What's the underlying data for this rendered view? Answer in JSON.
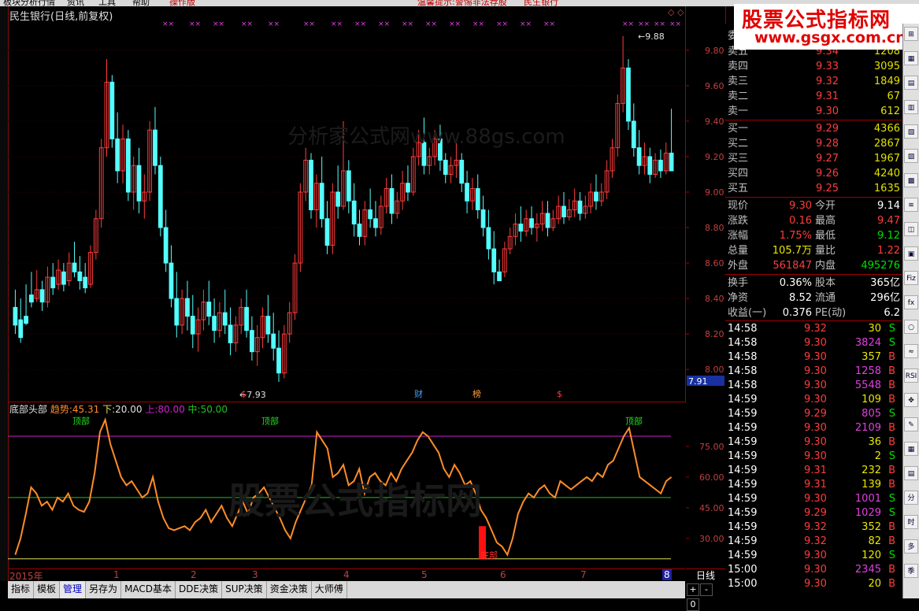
{
  "top_menu": [
    "板块分析行情",
    "资讯",
    "工具",
    "帮助",
    "操作版"
  ],
  "top_menu_highlight": [
    "温馨提示:警惕非法荐股",
    "民生银行"
  ],
  "chart": {
    "title": "民生银行(日线,前复权)",
    "watermark": "分析家公式网www.88gs.com",
    "watermark2": "股票公式指标网",
    "price_ticks": [
      "9.80",
      "9.60",
      "9.40",
      "9.20",
      "9.00",
      "8.80",
      "8.60",
      "8.40",
      "8.20",
      "8.00"
    ],
    "current_price_tag": "7.91",
    "high_label": "9.88",
    "low_label": "7.93",
    "event_markers": [
      "$",
      "财",
      "榜",
      "$"
    ]
  },
  "indicator": {
    "name": "底部头部",
    "trend_label": "趋势:",
    "trend_value": "45.31",
    "lower_label": "下:",
    "lower_value": "20.00",
    "upper_label": "上:",
    "upper_value": "80.00",
    "mid_label": "中:",
    "mid_value": "50.00",
    "ticks": [
      "75.00",
      "60.00",
      "45.00",
      "30.00"
    ],
    "top_label": "顶部",
    "bottom_label": "底部"
  },
  "date_axis": [
    "2015年",
    "1",
    "2",
    "3",
    "4",
    "5",
    "6",
    "7",
    "8"
  ],
  "period": "日线",
  "zoom_buttons": [
    "+",
    "-",
    "0"
  ],
  "tabs": [
    "指标",
    "模板",
    "管理",
    "另存为",
    "MACD基本",
    "DDE决策",
    "SUP决策",
    "资金决策",
    "大师傅"
  ],
  "tabs_active": "管理",
  "banner": {
    "line1": "股票公式指标网",
    "line2": "www.gsgx.com.cn"
  },
  "order_book": {
    "header_label": "委",
    "sell": [
      {
        "label": "卖五",
        "price": "9.34",
        "vol": "1208"
      },
      {
        "label": "卖四",
        "price": "9.33",
        "vol": "3095"
      },
      {
        "label": "卖三",
        "price": "9.32",
        "vol": "1849"
      },
      {
        "label": "卖二",
        "price": "9.31",
        "vol": "67"
      },
      {
        "label": "卖一",
        "price": "9.30",
        "vol": "612"
      }
    ],
    "buy": [
      {
        "label": "买一",
        "price": "9.29",
        "vol": "4366"
      },
      {
        "label": "买二",
        "price": "9.28",
        "vol": "2867"
      },
      {
        "label": "买三",
        "price": "9.27",
        "vol": "1967"
      },
      {
        "label": "买四",
        "price": "9.26",
        "vol": "4240"
      },
      {
        "label": "买五",
        "price": "9.25",
        "vol": "1635"
      }
    ]
  },
  "stats": [
    {
      "l1": "现价",
      "v1": "9.30",
      "c1": "red",
      "l2": "今开",
      "v2": "9.14",
      "c2": "white"
    },
    {
      "l1": "涨跌",
      "v1": "0.16",
      "c1": "red",
      "l2": "最高",
      "v2": "9.47",
      "c2": "red"
    },
    {
      "l1": "涨幅",
      "v1": "1.75%",
      "c1": "red",
      "l2": "最低",
      "v2": "9.12",
      "c2": "green"
    },
    {
      "l1": "总量",
      "v1": "105.7万",
      "c1": "yellow",
      "l2": "量比",
      "v2": "1.22",
      "c2": "red"
    },
    {
      "l1": "外盘",
      "v1": "561847",
      "c1": "red",
      "l2": "内盘",
      "v2": "495276",
      "c2": "green"
    }
  ],
  "stats2": [
    {
      "l1": "换手",
      "v1": "0.36%",
      "l2": "股本",
      "v2": "365亿"
    },
    {
      "l1": "净资",
      "v1": "8.52",
      "l2": "流通",
      "v2": "296亿"
    },
    {
      "l1": "收益(一)",
      "v1": "0.376",
      "l2": "PE(动)",
      "v2": "6.2"
    }
  ],
  "ticks": [
    {
      "t": "14:58",
      "p": "9.32",
      "v": "30",
      "s": "S",
      "vc": "yellow",
      "sc": "green"
    },
    {
      "t": "14:58",
      "p": "9.30",
      "v": "3824",
      "s": "S",
      "vc": "magenta",
      "sc": "green"
    },
    {
      "t": "14:58",
      "p": "9.30",
      "v": "357",
      "s": "B",
      "vc": "yellow",
      "sc": "red"
    },
    {
      "t": "14:58",
      "p": "9.30",
      "v": "1258",
      "s": "B",
      "vc": "magenta",
      "sc": "red"
    },
    {
      "t": "14:58",
      "p": "9.30",
      "v": "5548",
      "s": "B",
      "vc": "magenta",
      "sc": "red"
    },
    {
      "t": "14:59",
      "p": "9.30",
      "v": "109",
      "s": "B",
      "vc": "yellow",
      "sc": "red"
    },
    {
      "t": "14:59",
      "p": "9.29",
      "v": "805",
      "s": "S",
      "vc": "magenta",
      "sc": "green"
    },
    {
      "t": "14:59",
      "p": "9.30",
      "v": "2109",
      "s": "B",
      "vc": "magenta",
      "sc": "red"
    },
    {
      "t": "14:59",
      "p": "9.30",
      "v": "36",
      "s": "B",
      "vc": "yellow",
      "sc": "red"
    },
    {
      "t": "14:59",
      "p": "9.30",
      "v": "2",
      "s": "S",
      "vc": "yellow",
      "sc": "green"
    },
    {
      "t": "14:59",
      "p": "9.31",
      "v": "232",
      "s": "B",
      "vc": "yellow",
      "sc": "red"
    },
    {
      "t": "14:59",
      "p": "9.31",
      "v": "139",
      "s": "B",
      "vc": "yellow",
      "sc": "red"
    },
    {
      "t": "14:59",
      "p": "9.30",
      "v": "1001",
      "s": "S",
      "vc": "magenta",
      "sc": "green"
    },
    {
      "t": "14:59",
      "p": "9.29",
      "v": "1029",
      "s": "S",
      "vc": "magenta",
      "sc": "green"
    },
    {
      "t": "14:59",
      "p": "9.32",
      "v": "352",
      "s": "B",
      "vc": "yellow",
      "sc": "red"
    },
    {
      "t": "14:59",
      "p": "9.32",
      "v": "82",
      "s": "B",
      "vc": "yellow",
      "sc": "red"
    },
    {
      "t": "14:59",
      "p": "9.30",
      "v": "120",
      "s": "S",
      "vc": "yellow",
      "sc": "green"
    },
    {
      "t": "15:00",
      "p": "9.30",
      "v": "2345",
      "s": "B",
      "vc": "magenta",
      "sc": "red"
    },
    {
      "t": "15:00",
      "p": "9.30",
      "v": "20",
      "s": "B",
      "vc": "yellow",
      "sc": "red"
    }
  ],
  "toolbox": [
    "⊞",
    "▦",
    "▤",
    "▥",
    "▧",
    "▨",
    "▩",
    "≋",
    "◫",
    "▣",
    "Fiz",
    "fx",
    "○",
    "≈",
    "RSI",
    "✥",
    "✎",
    "▦",
    "▤",
    "分",
    "时",
    "多",
    "季"
  ],
  "colors": {
    "up": "#ff3c3c",
    "down": "#54ffff",
    "indicator": "#ff8c28",
    "upper_line": "#d020d0",
    "mid_line": "#20c020",
    "lower_line": "#e0e060"
  },
  "chart_data": {
    "type": "candlestick",
    "price_range": [
      7.85,
      9.95
    ],
    "indicator_range": [
      18,
      90
    ],
    "candles": [
      [
        8.35,
        8.45,
        8.25,
        8.2
      ],
      [
        8.28,
        8.4,
        8.18,
        8.15
      ],
      [
        8.3,
        8.48,
        8.26,
        8.25
      ],
      [
        8.42,
        8.55,
        8.38,
        8.35
      ],
      [
        8.4,
        8.56,
        8.45,
        8.38
      ],
      [
        8.45,
        8.5,
        8.38,
        8.33
      ],
      [
        8.38,
        8.58,
        8.52,
        8.35
      ],
      [
        8.52,
        8.6,
        8.46,
        8.42
      ],
      [
        8.48,
        8.62,
        8.56,
        8.45
      ],
      [
        8.55,
        8.6,
        8.48,
        8.44
      ],
      [
        8.5,
        8.66,
        8.6,
        8.47
      ],
      [
        8.6,
        8.72,
        8.55,
        8.52
      ],
      [
        8.55,
        8.64,
        8.5,
        8.45
      ],
      [
        8.52,
        8.6,
        8.46,
        8.43
      ],
      [
        8.48,
        8.7,
        8.66,
        8.46
      ],
      [
        8.66,
        8.9,
        8.85,
        8.62
      ],
      [
        8.85,
        9.3,
        9.25,
        8.8
      ],
      [
        9.25,
        9.75,
        9.62,
        9.2
      ],
      [
        9.62,
        9.66,
        9.3,
        9.25
      ],
      [
        9.3,
        9.45,
        9.12,
        9.05
      ],
      [
        9.12,
        9.38,
        9.3,
        9.05
      ],
      [
        9.3,
        9.35,
        9.0,
        8.95
      ],
      [
        9.0,
        9.2,
        9.15,
        8.9
      ],
      [
        9.15,
        9.25,
        8.95,
        8.88
      ],
      [
        8.95,
        9.1,
        9.0,
        8.85
      ],
      [
        9.0,
        9.4,
        9.35,
        8.95
      ],
      [
        9.35,
        9.48,
        9.15,
        9.1
      ],
      [
        9.15,
        9.2,
        8.8,
        8.75
      ],
      [
        8.8,
        8.9,
        8.6,
        8.55
      ],
      [
        8.6,
        8.7,
        8.4,
        8.35
      ],
      [
        8.4,
        8.55,
        8.25,
        8.18
      ],
      [
        8.25,
        8.45,
        8.4,
        8.2
      ],
      [
        8.4,
        8.5,
        8.3,
        8.22
      ],
      [
        8.3,
        8.42,
        8.2,
        8.12
      ],
      [
        8.2,
        8.35,
        8.28,
        8.1
      ],
      [
        8.28,
        8.45,
        8.38,
        8.22
      ],
      [
        8.38,
        8.5,
        8.3,
        8.25
      ],
      [
        8.3,
        8.4,
        8.22,
        8.15
      ],
      [
        8.22,
        8.38,
        8.32,
        8.18
      ],
      [
        8.32,
        8.45,
        8.25,
        8.2
      ],
      [
        8.25,
        8.35,
        8.15,
        8.08
      ],
      [
        8.15,
        8.3,
        8.25,
        8.1
      ],
      [
        8.25,
        8.4,
        8.35,
        8.2
      ],
      [
        8.35,
        8.45,
        8.22,
        8.18
      ],
      [
        8.22,
        8.3,
        8.1,
        8.05
      ],
      [
        8.1,
        8.25,
        8.18,
        8.02
      ],
      [
        8.18,
        8.35,
        8.3,
        8.12
      ],
      [
        8.3,
        8.42,
        8.2,
        8.15
      ],
      [
        8.2,
        8.32,
        8.12,
        8.05
      ],
      [
        8.12,
        8.22,
        7.98,
        7.93
      ],
      [
        7.98,
        8.25,
        8.2,
        7.95
      ],
      [
        8.2,
        8.38,
        8.32,
        8.15
      ],
      [
        8.32,
        8.65,
        8.6,
        8.28
      ],
      [
        8.6,
        9.05,
        9.0,
        8.55
      ],
      [
        9.0,
        9.25,
        9.18,
        8.95
      ],
      [
        9.18,
        9.22,
        8.9,
        8.85
      ],
      [
        8.9,
        9.1,
        9.05,
        8.8
      ],
      [
        9.05,
        9.2,
        8.85,
        8.8
      ],
      [
        8.85,
        8.95,
        8.7,
        8.65
      ],
      [
        8.7,
        9.05,
        9.0,
        8.65
      ],
      [
        9.0,
        9.15,
        8.92,
        8.85
      ],
      [
        8.92,
        9.4,
        9.12,
        8.9
      ],
      [
        9.12,
        9.18,
        8.95,
        8.88
      ],
      [
        8.95,
        9.05,
        8.82,
        8.75
      ],
      [
        8.82,
        8.9,
        8.75,
        8.7
      ],
      [
        8.75,
        8.95,
        8.9,
        8.7
      ],
      [
        8.9,
        9.02,
        8.85,
        8.8
      ],
      [
        8.85,
        8.95,
        8.8,
        8.75
      ],
      [
        8.8,
        8.98,
        8.92,
        8.76
      ],
      [
        8.92,
        9.08,
        9.02,
        8.88
      ],
      [
        9.02,
        9.1,
        8.88,
        8.82
      ],
      [
        8.88,
        9.0,
        8.95,
        8.85
      ],
      [
        8.95,
        9.12,
        9.05,
        8.9
      ],
      [
        9.05,
        9.15,
        9.0,
        8.95
      ],
      [
        9.0,
        9.25,
        9.2,
        8.98
      ],
      [
        9.2,
        9.35,
        9.28,
        9.15
      ],
      [
        9.28,
        9.42,
        9.15,
        9.1
      ],
      [
        9.15,
        9.25,
        9.2,
        9.1
      ],
      [
        9.2,
        9.35,
        9.3,
        9.15
      ],
      [
        9.3,
        9.38,
        9.18,
        9.12
      ],
      [
        9.18,
        9.22,
        9.1,
        9.05
      ],
      [
        9.1,
        9.2,
        9.15,
        9.05
      ],
      [
        9.15,
        9.3,
        9.18,
        9.08
      ],
      [
        9.18,
        9.22,
        9.05,
        9.0
      ],
      [
        9.05,
        9.12,
        8.95,
        8.88
      ],
      [
        8.95,
        9.08,
        9.02,
        8.9
      ],
      [
        9.02,
        9.1,
        8.9,
        8.85
      ],
      [
        8.9,
        8.98,
        8.8,
        8.75
      ],
      [
        8.8,
        8.9,
        8.68,
        8.62
      ],
      [
        8.68,
        8.78,
        8.55,
        8.48
      ],
      [
        8.55,
        8.62,
        8.5,
        8.52
      ],
      [
        8.55,
        8.72,
        8.68,
        8.52
      ],
      [
        8.68,
        8.8,
        8.75,
        8.65
      ],
      [
        8.75,
        8.88,
        8.82,
        8.7
      ],
      [
        8.82,
        8.92,
        8.78,
        8.72
      ],
      [
        8.78,
        8.9,
        8.85,
        8.75
      ],
      [
        8.85,
        8.92,
        8.8,
        8.76
      ],
      [
        8.8,
        8.88,
        8.82,
        8.72
      ],
      [
        8.82,
        8.95,
        8.88,
        8.78
      ],
      [
        8.88,
        8.95,
        8.8,
        8.75
      ],
      [
        8.8,
        8.9,
        8.85,
        8.78
      ],
      [
        8.85,
        8.98,
        8.92,
        8.82
      ],
      [
        8.92,
        9.0,
        8.86,
        8.82
      ],
      [
        8.86,
        8.96,
        8.9,
        8.84
      ],
      [
        8.9,
        9.02,
        8.95,
        8.86
      ],
      [
        8.95,
        9.0,
        8.88,
        8.84
      ],
      [
        8.88,
        8.98,
        8.92,
        8.85
      ],
      [
        8.92,
        9.05,
        9.0,
        8.88
      ],
      [
        9.0,
        9.1,
        8.95,
        8.9
      ],
      [
        8.95,
        9.05,
        9.0,
        8.92
      ],
      [
        9.0,
        9.18,
        9.12,
        8.96
      ],
      [
        9.12,
        9.3,
        9.25,
        9.08
      ],
      [
        9.25,
        9.55,
        9.5,
        9.2
      ],
      [
        9.5,
        9.88,
        9.7,
        9.45
      ],
      [
        9.7,
        9.75,
        9.4,
        9.35
      ],
      [
        9.4,
        9.5,
        9.25,
        9.2
      ],
      [
        9.25,
        9.35,
        9.15,
        9.1
      ],
      [
        9.15,
        9.28,
        9.2,
        9.1
      ],
      [
        9.2,
        9.25,
        9.1,
        9.05
      ],
      [
        9.1,
        9.22,
        9.18,
        9.08
      ],
      [
        9.18,
        9.24,
        9.12,
        9.08
      ],
      [
        9.12,
        9.28,
        9.22,
        9.1
      ],
      [
        9.22,
        9.47,
        9.12,
        9.12
      ]
    ],
    "indicator_values": [
      22,
      30,
      42,
      55,
      52,
      46,
      48,
      44,
      50,
      48,
      52,
      46,
      44,
      43,
      48,
      62,
      82,
      88,
      76,
      68,
      60,
      56,
      58,
      54,
      50,
      52,
      60,
      48,
      40,
      35,
      34,
      35,
      36,
      34,
      38,
      40,
      44,
      38,
      42,
      46,
      40,
      36,
      42,
      48,
      42,
      50,
      52,
      55,
      50,
      45,
      40,
      34,
      30,
      38,
      44,
      50,
      56,
      82,
      78,
      74,
      60,
      62,
      66,
      56,
      58,
      64,
      52,
      60,
      62,
      58,
      56,
      62,
      58,
      64,
      68,
      72,
      78,
      82,
      80,
      76,
      72,
      64,
      60,
      66,
      62,
      56,
      58,
      52,
      44,
      40,
      34,
      28,
      26,
      22,
      30,
      42,
      48,
      52,
      50,
      54,
      56,
      52,
      50,
      58,
      56,
      54,
      56,
      58,
      60,
      58,
      62,
      60,
      66,
      68,
      74,
      80,
      84,
      72,
      60,
      58,
      56,
      54,
      52,
      58,
      60
    ]
  }
}
